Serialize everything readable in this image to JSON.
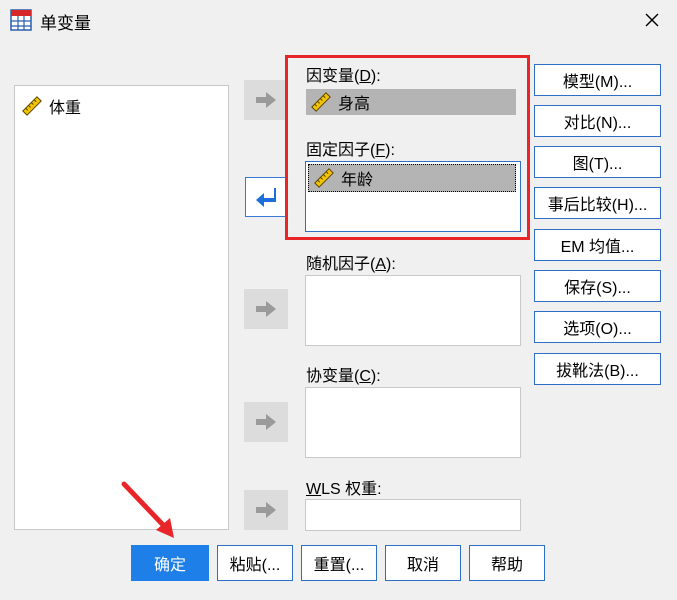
{
  "window": {
    "title": "单变量",
    "app_icon": "spss-grid-icon",
    "close_icon": "close-icon"
  },
  "variables": {
    "items": [
      {
        "name": "体重",
        "icon": "ruler-scale-icon"
      }
    ]
  },
  "fields": {
    "dependent": {
      "label_pre": "因变量(",
      "label_key": "D",
      "label_post": "):",
      "value": "身高",
      "icon": "ruler-scale-icon"
    },
    "fixed": {
      "label_pre": "固定因子(",
      "label_key": "F",
      "label_post": "):",
      "value": "年龄",
      "icon": "ruler-scale-icon"
    },
    "random": {
      "label_pre": "随机因子(",
      "label_key": "A",
      "label_post": "):"
    },
    "covariate": {
      "label_pre": "协变量(",
      "label_key": "C",
      "label_post": "):"
    },
    "wls": {
      "label_key": "W",
      "label_rest": "LS 权重:"
    }
  },
  "side_buttons": [
    {
      "label": "模型(M)..."
    },
    {
      "label": "对比(N)..."
    },
    {
      "label": "图(T)..."
    },
    {
      "label": "事后比较(H)..."
    },
    {
      "label": "EM 均值..."
    },
    {
      "label": "保存(S)..."
    },
    {
      "label": "选项(O)..."
    },
    {
      "label": "拔靴法(B)..."
    }
  ],
  "bottom_buttons": {
    "ok": "确定",
    "paste": "粘贴(...",
    "reset": "重置(...",
    "cancel": "取消",
    "help": "帮助"
  },
  "colors": {
    "accent": "#1e7fe8",
    "highlight": "#e8262a",
    "selected": "#b4b4b4"
  }
}
